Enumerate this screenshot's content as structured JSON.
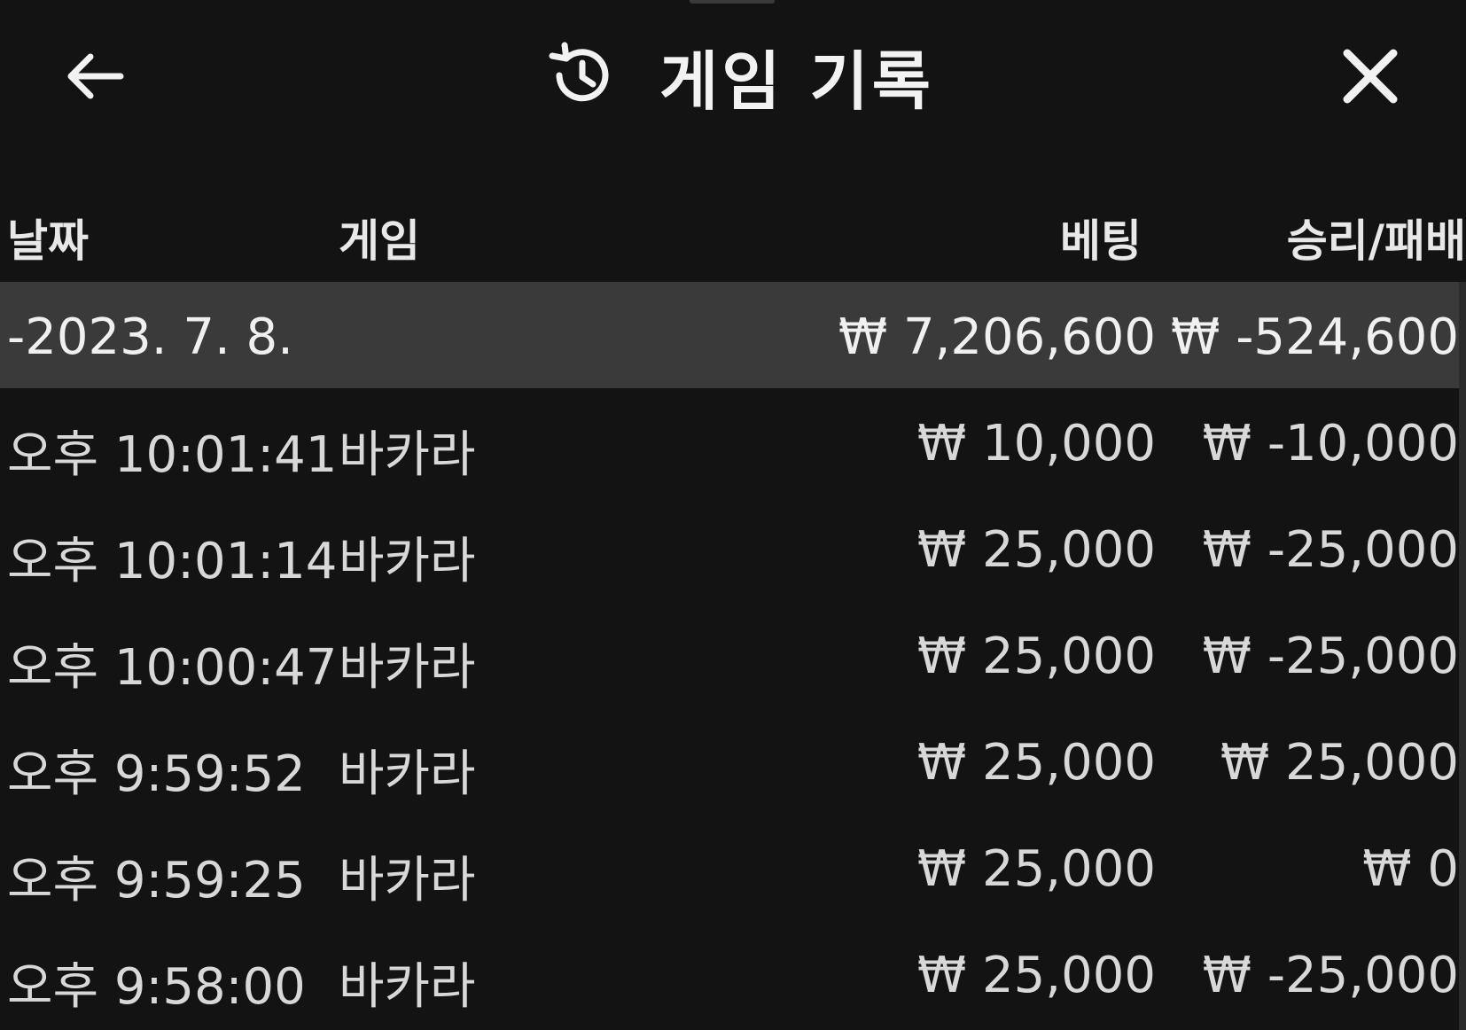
{
  "header": {
    "title": "게임 기록",
    "back_icon": "arrow-left-icon",
    "history_icon": "history-icon",
    "close_icon": "close-icon"
  },
  "columns": {
    "date": "날짜",
    "game": "게임",
    "bet": "베팅",
    "result": "승리/패배"
  },
  "summary": {
    "date": "-2023. 7. 8.",
    "bet": "₩ 7,206,600",
    "result": "₩ -524,600"
  },
  "rows": [
    {
      "time": "오후 10:01:41",
      "game": "바카라",
      "bet": "₩ 10,000",
      "result": "₩ -10,000"
    },
    {
      "time": "오후 10:01:14",
      "game": "바카라",
      "bet": "₩ 25,000",
      "result": "₩ -25,000"
    },
    {
      "time": "오후 10:00:47",
      "game": "바카라",
      "bet": "₩ 25,000",
      "result": "₩ -25,000"
    },
    {
      "time": "오후 9:59:52",
      "game": "바카라",
      "bet": "₩ 25,000",
      "result": "₩ 25,000"
    },
    {
      "time": "오후 9:59:25",
      "game": "바카라",
      "bet": "₩ 25,000",
      "result": "₩ 0"
    },
    {
      "time": "오후 9:58:00",
      "game": "바카라",
      "bet": "₩ 25,000",
      "result": "₩ -25,000"
    }
  ],
  "colors": {
    "background": "#131313",
    "summary_row": "#3a3a3a",
    "text": "#e6e6e6"
  }
}
